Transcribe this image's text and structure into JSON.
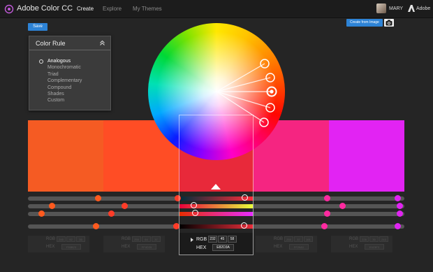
{
  "app": {
    "title": "Adobe Color CC"
  },
  "nav": {
    "tabs": [
      "Create",
      "Explore",
      "My Themes"
    ],
    "active": "Create"
  },
  "user": {
    "name": "MARY",
    "brand": "Adobe"
  },
  "toolbar": {
    "save_label": "Save",
    "create_from_image_label": "Create from Image"
  },
  "color_rule": {
    "title": "Color Rule",
    "options": [
      "Analogous",
      "Monochromatic",
      "Triad",
      "Complementary",
      "Compound",
      "Shades",
      "Custom"
    ],
    "selected": "Analogous"
  },
  "swatches": [
    {
      "color": "#f55b23",
      "rgb": [
        "245",
        "92",
        "35"
      ],
      "hex": "F55B23"
    },
    {
      "color": "#ff4d25",
      "rgb": [
        "255",
        "64",
        "37"
      ],
      "hex": "FF4D25"
    },
    {
      "color": "#e8293a",
      "rgb": [
        "232",
        "45",
        "58"
      ],
      "hex": "E82D3A",
      "active": true
    },
    {
      "color": "#f52581",
      "rgb": [
        "255",
        "37",
        "161"
      ],
      "hex": "FF25A1"
    },
    {
      "color": "#e223f3",
      "rgb": [
        "226",
        "35",
        "243"
      ],
      "hex": "E023F3"
    }
  ],
  "labels": {
    "rgb": "RGB",
    "hex": "HEX"
  },
  "colors": {
    "accent": "#2d83d6",
    "background": "#252525"
  }
}
